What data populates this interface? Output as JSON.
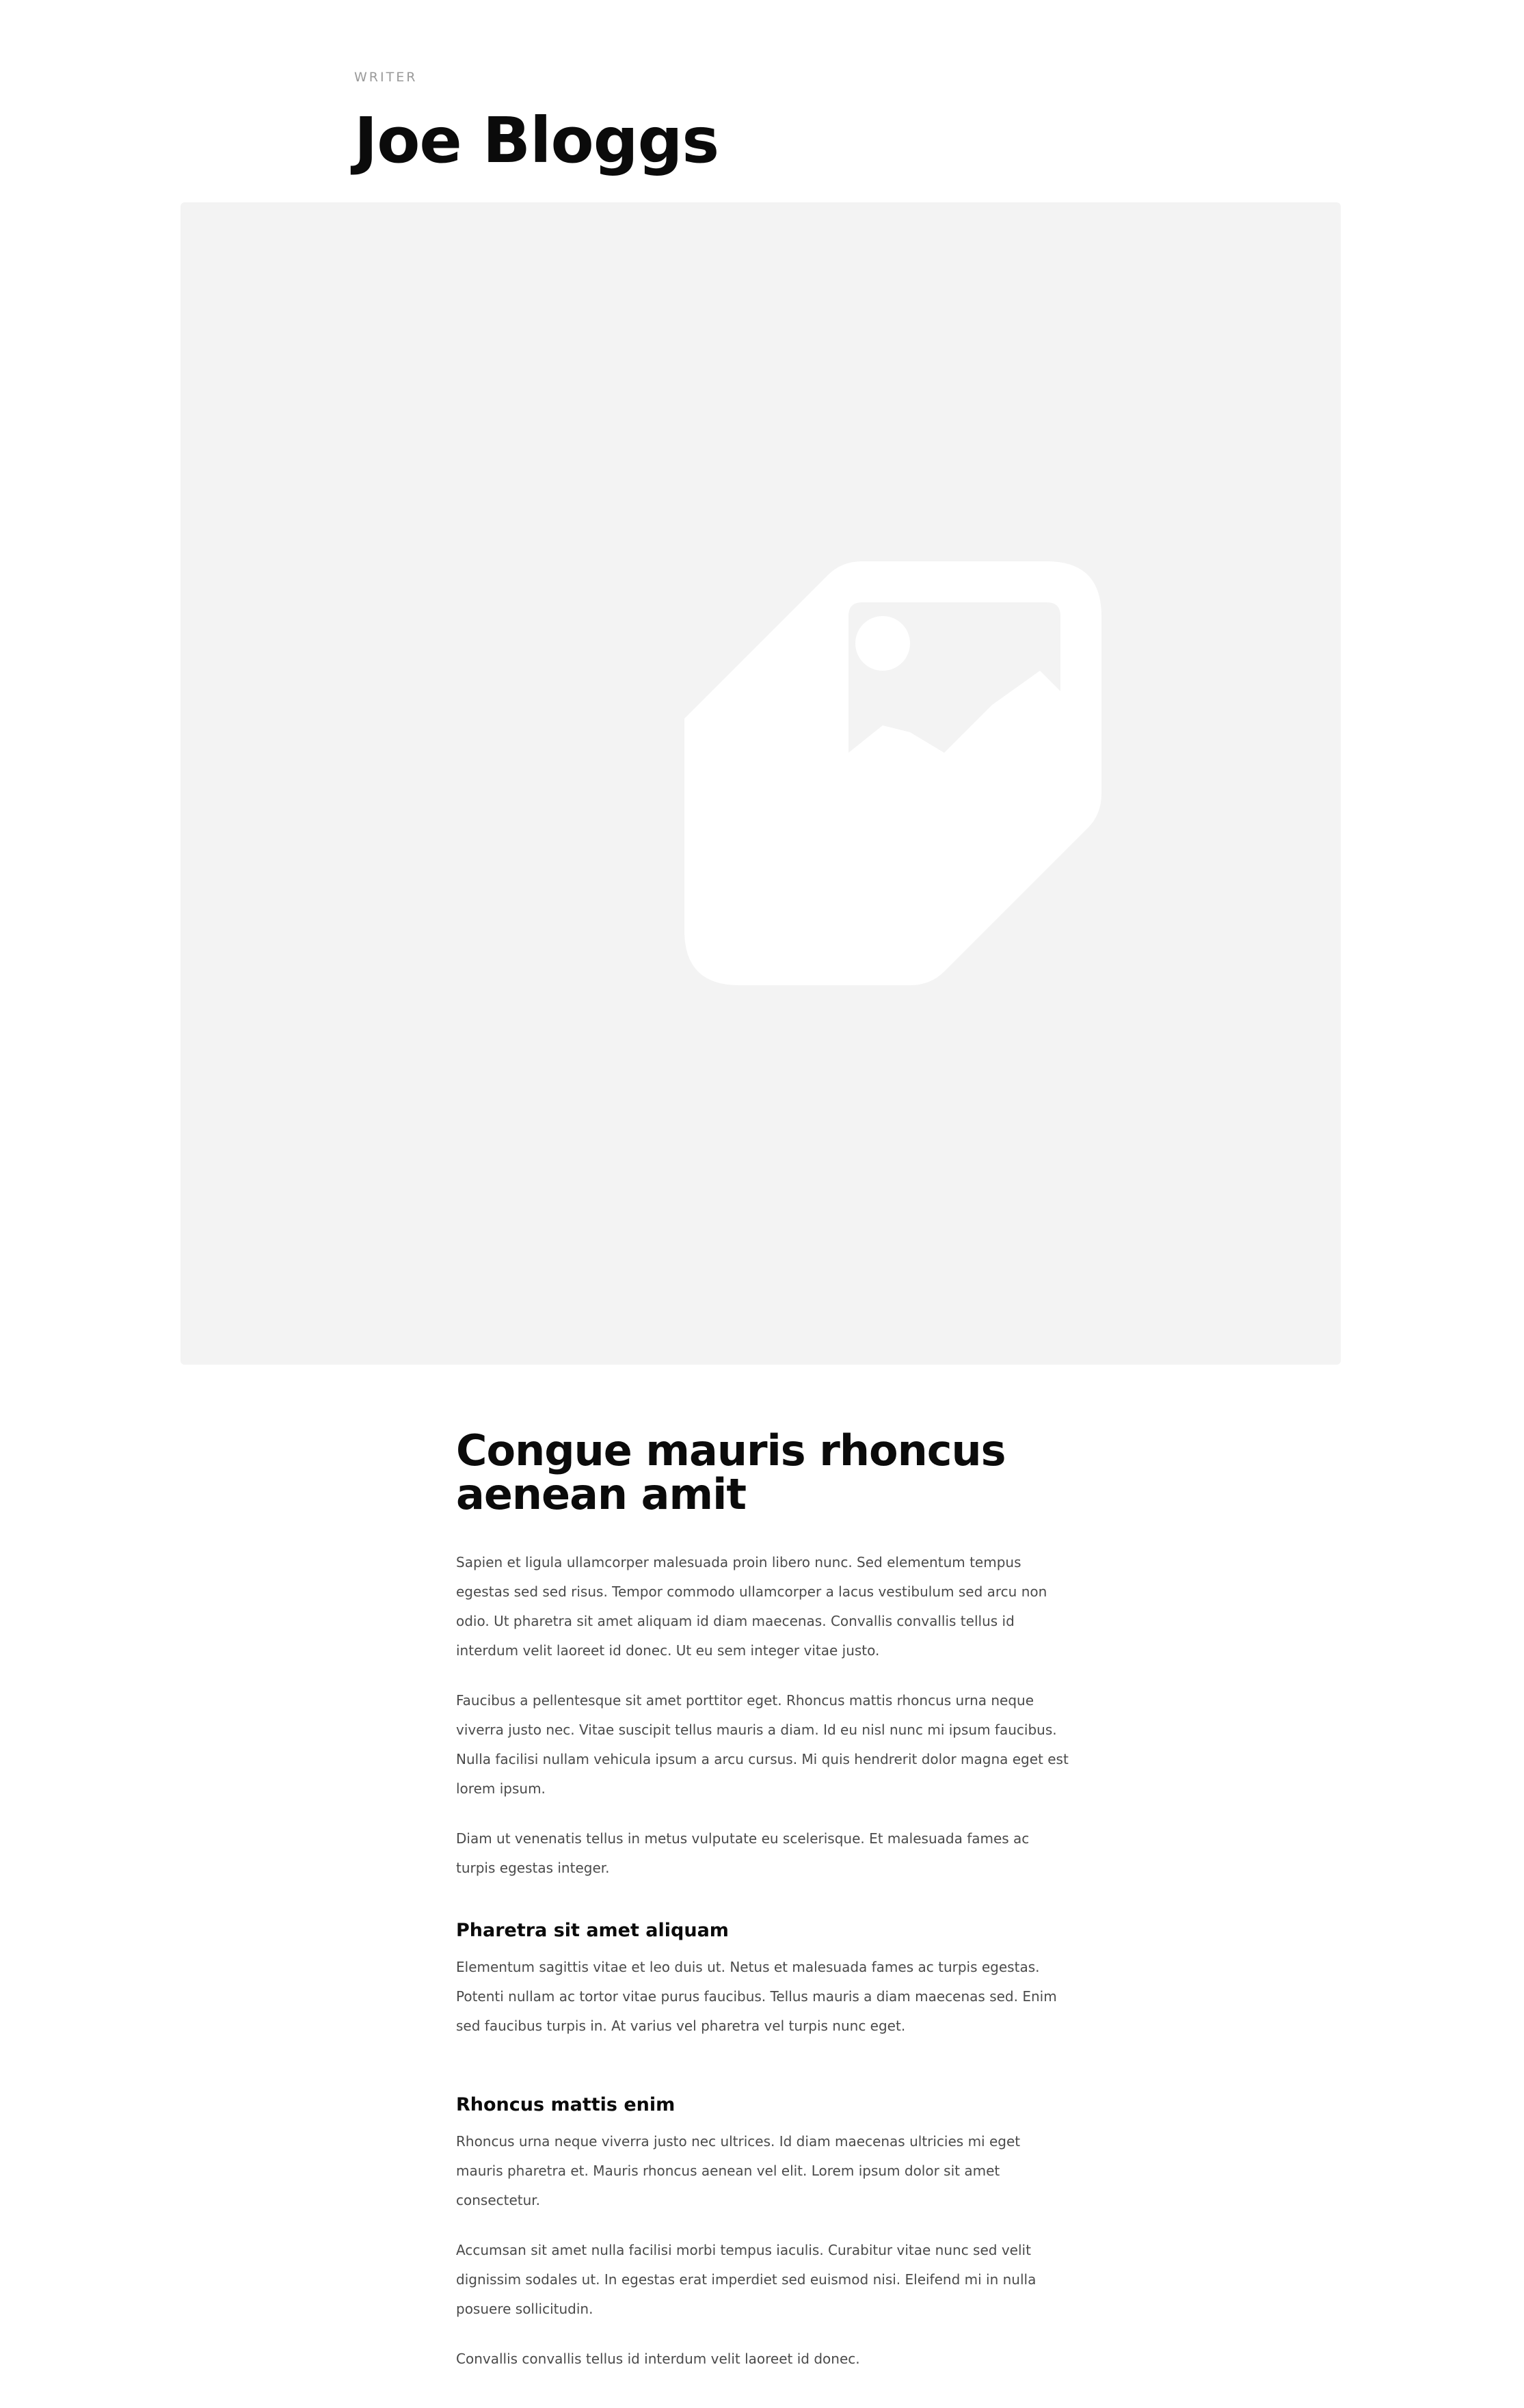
{
  "header": {
    "eyebrow": "WRITER",
    "name": "Joe Bloggs"
  },
  "hero": {
    "icon": "image-placeholder-icon",
    "colors": {
      "background": "#f3f3f3",
      "icon": "#ffffff"
    }
  },
  "article": {
    "title": "Congue mauris rhoncus aenean amit",
    "intro_paragraphs": [
      "Sapien et ligula ullamcorper malesuada proin libero nunc. Sed elementum tempus egestas sed sed risus. Tempor commodo ullamcorper a lacus vestibulum sed arcu non odio. Ut pharetra sit amet aliquam id diam maecenas. Convallis convallis tellus id interdum velit laoreet id donec. Ut eu sem integer vitae justo.",
      "Faucibus a pellentesque sit amet porttitor eget. Rhoncus mattis rhoncus urna neque viverra justo nec. Vitae suscipit tellus mauris a diam. Id eu nisl nunc mi ipsum faucibus. Nulla facilisi nullam vehicula ipsum a arcu cursus. Mi quis hendrerit dolor magna eget est lorem ipsum.",
      "Diam ut venenatis tellus in metus vulputate eu scelerisque. Et malesuada fames ac turpis egestas integer."
    ],
    "sections": [
      {
        "heading": "Pharetra sit amet aliquam",
        "paragraphs": [
          "Elementum sagittis vitae et leo duis ut. Netus et malesuada fames ac turpis egestas. Potenti nullam ac tortor vitae purus faucibus. Tellus mauris a diam maecenas sed. Enim sed faucibus turpis in. At varius vel pharetra vel turpis nunc eget."
        ]
      },
      {
        "heading": "Rhoncus mattis enim",
        "paragraphs": [
          "Rhoncus urna neque viverra justo nec ultrices. Id diam maecenas ultricies mi eget mauris pharetra et. Mauris rhoncus aenean vel elit. Lorem ipsum dolor sit amet consectetur.",
          "Accumsan sit amet nulla facilisi morbi tempus iaculis. Curabitur vitae nunc sed velit dignissim sodales ut. In egestas erat imperdiet sed euismod nisi. Eleifend mi in nulla posuere sollicitudin.",
          "Convallis convallis tellus id interdum velit laoreet id donec."
        ]
      }
    ]
  }
}
